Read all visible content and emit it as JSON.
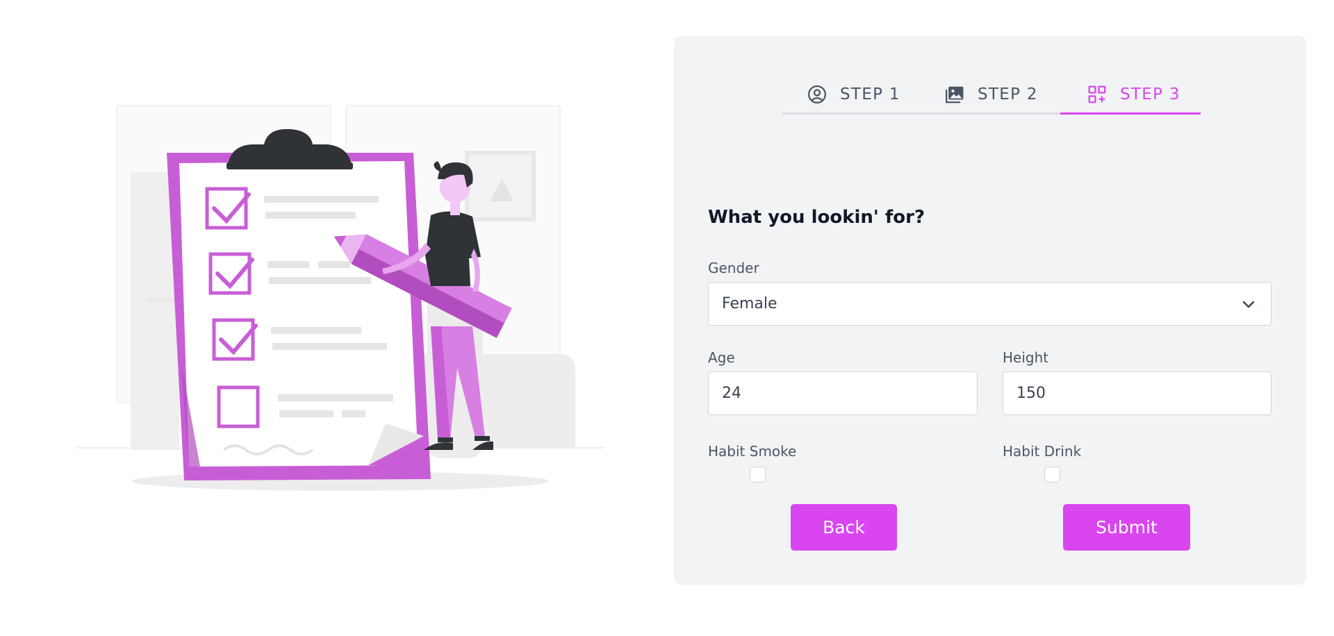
{
  "steps": [
    {
      "label": "STEP 1",
      "icon": "user-circle-icon"
    },
    {
      "label": "STEP 2",
      "icon": "image-icon"
    },
    {
      "label": "STEP 3",
      "icon": "grid-plus-icon"
    }
  ],
  "active_step": 3,
  "form": {
    "title": "What you lookin' for?",
    "gender_label": "Gender",
    "gender_value": "Female",
    "age_label": "Age",
    "age_value": "24",
    "height_label": "Height",
    "height_value": "150",
    "smoke_label": "Habit Smoke",
    "smoke_checked": false,
    "drink_label": "Habit Drink",
    "drink_checked": false
  },
  "buttons": {
    "back_label": "Back",
    "submit_label": "Submit"
  },
  "colors": {
    "accent": "#d946ef",
    "card_bg": "#f2f3f5",
    "illustration_primary": "#c85ed6"
  }
}
